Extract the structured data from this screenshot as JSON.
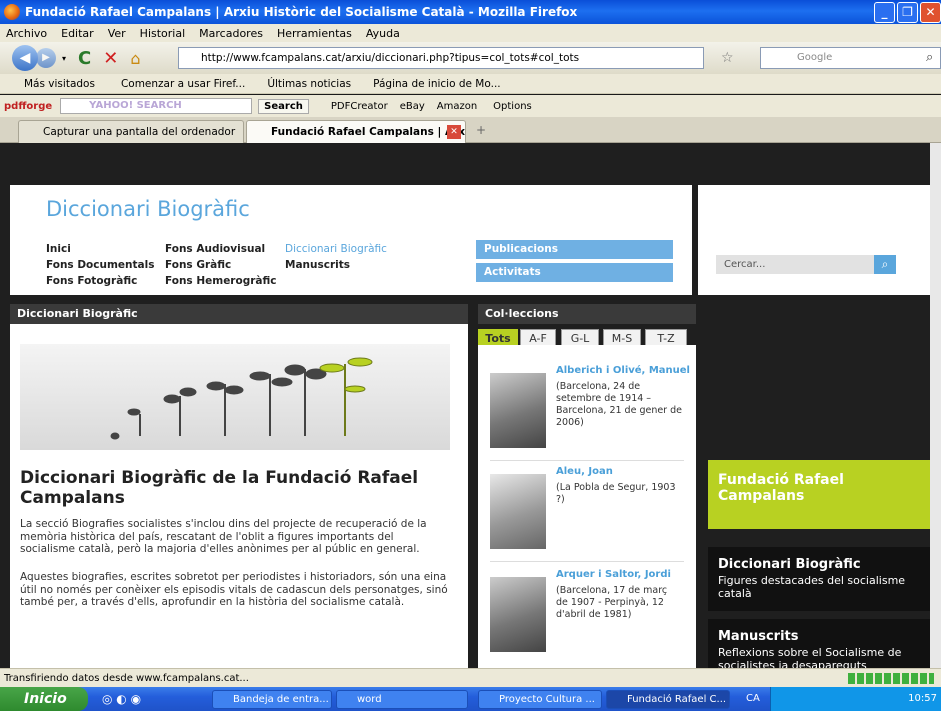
{
  "window": {
    "title": "Fundació Rafael Campalans | Arxiu Històric del Socialisme Català - Mozilla Firefox"
  },
  "menu": [
    "Archivo",
    "Editar",
    "Ver",
    "Historial",
    "Marcadores",
    "Herramientas",
    "Ayuda"
  ],
  "nav": {
    "url": "http://www.fcampalans.cat/arxiu/diccionari.php?tipus=col_tots#col_tots",
    "search_placeholder": "Google"
  },
  "bookmarks": [
    "Más visitados",
    "Comenzar a usar Firef...",
    "Últimas noticias",
    "Página de inicio de Mo..."
  ],
  "toolbar": {
    "brand": "pdfforge",
    "yahoo": "YAHOO! SEARCH",
    "search_btn": "Search",
    "items": [
      "PDFCreator",
      "eBay",
      "Amazon",
      "Options"
    ]
  },
  "tabs": [
    {
      "label": "Capturar una pantalla del ordenador"
    },
    {
      "label": "Fundació Rafael Campalans | Arx..."
    }
  ],
  "site": {
    "title": "Diccionari Biogràfic",
    "nav_links": [
      [
        "Inici",
        "Fons Audiovisual",
        "Diccionari Biogràfic"
      ],
      [
        "Fons Documentals",
        "Fons Gràfic",
        "Manuscrits"
      ],
      [
        "Fons Fotogràfic",
        "Fons Hemerogràfic",
        ""
      ]
    ],
    "publicacions": "Publicacions",
    "activitats": "Activitats",
    "search_placeholder": "Cercar...",
    "section_title": "Diccionari Biogràfic",
    "collections_title": "Col·leccions",
    "filter_tabs": [
      "Tots",
      "A-F",
      "G-L",
      "M-S",
      "T-Z"
    ],
    "article_title": "Diccionari Biogràfic de la Fundació Rafael Campalans",
    "p1": "La secció Biografies socialistes s'inclou dins del projecte de recuperació de la memòria històrica del país, rescatant de l'oblit a figures importants del socialisme català, però la majoria d'elles anònimes per al públic en general.",
    "p2": "Aquestes biografies, escrites sobretot per periodistes i historiadors, són una eina útil no només per conèixer els episodis vitals de cadascun dels personatges, sinó també per, a través d'ells, aprofundir en la història del socialisme català.",
    "people": [
      {
        "name": "Alberich i Olivé, Manuel",
        "desc": "(Barcelona, 24 de setembre de 1914 – Barcelona, 21 de gener de 2006)"
      },
      {
        "name": "Aleu, Joan",
        "desc": "(La Pobla de Segur, 1903 ?)"
      },
      {
        "name": "Arquer i Saltor, Jordi",
        "desc": "(Barcelona, 17 de març de 1907 - Perpinyà, 12 d'abril de 1981)"
      }
    ],
    "promo_green": "Fundació Rafael Campalans",
    "promo1_title": "Diccionari Biogràfic",
    "promo1_sub": "Figures destacades del socialisme català",
    "promo2_title": "Manuscrits",
    "promo2_sub": "Reflexions sobre el Socialisme de socialistes ja desapareguts"
  },
  "status": "Transfiriendo datos desde www.fcampalans.cat...",
  "taskbar": {
    "start": "Inicio",
    "buttons": [
      "Bandeja de entra...",
      "word",
      "Proyecto Cultura ...",
      "Fundació Rafael C..."
    ],
    "lang": "CA",
    "clock": "10:57"
  }
}
